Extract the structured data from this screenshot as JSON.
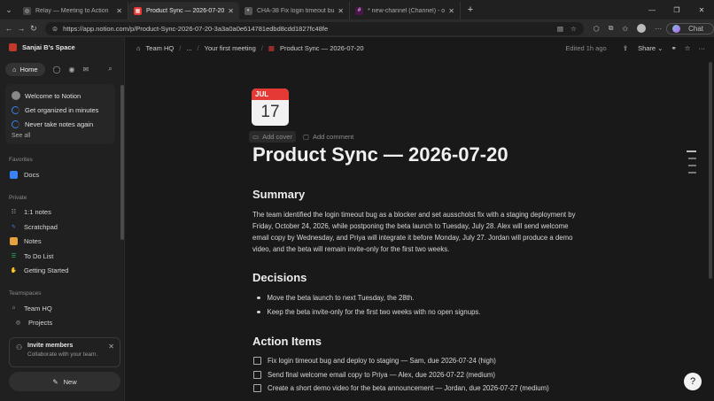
{
  "browser": {
    "tabs": [
      {
        "title": "Relay — Meeting to Action",
        "active": false
      },
      {
        "title": "Product Sync — 2026-07-20 | Notion",
        "active": true
      },
      {
        "title": "CHA-38 Fix login timeout bug and",
        "active": false
      },
      {
        "title": "* new-channel (Channel) - openai",
        "active": false
      }
    ],
    "url": "https://app.notion.com/p/Product-Sync-2026-07-20-3a3a0a0e614781edbd8cdd1827fc48fe",
    "chat_label": "Chat"
  },
  "sidebar": {
    "workspace": "Sanjai B's Space",
    "home_label": "Home",
    "onboarding": [
      {
        "label": "Welcome to Notion"
      },
      {
        "label": "Get organized in minutes"
      },
      {
        "label": "Never take notes again"
      }
    ],
    "see_all": "See all",
    "favorites_header": "Favorites",
    "favorites": [
      {
        "label": "Docs",
        "color": "#3b82f6"
      }
    ],
    "private_header": "Private",
    "private": [
      {
        "label": "1:1 notes",
        "color": "#888888"
      },
      {
        "label": "Scratchpad",
        "color": "#3b82f6"
      },
      {
        "label": "Notes",
        "color": "#e6a23c"
      },
      {
        "label": "To Do List",
        "color": "#22c55e"
      },
      {
        "label": "Getting Started",
        "color": "#f5c542"
      }
    ],
    "teamspaces_header": "Teamspaces",
    "teamspaces": [
      {
        "label": "Team HQ"
      },
      {
        "label": "Projects"
      }
    ],
    "invite_title": "Invite members",
    "invite_sub": "Collaborate with your team.",
    "new_label": "New"
  },
  "topbar": {
    "breadcrumb": [
      "Team HQ",
      "...",
      "Your first meeting",
      "Product Sync — 2026-07-20"
    ],
    "edited": "Edited 1h ago",
    "share": "Share"
  },
  "page": {
    "cal_month": "JUL",
    "cal_day": "17",
    "add_cover": "Add cover",
    "add_comment": "Add comment",
    "title": "Product Sync — 2026-07-20",
    "summary_heading": "Summary",
    "summary_text": "The team identified the login timeout bug as a blocker and set ausscholst fix with a staging deployment by Friday, October 24, 2026, while postponing the beta launch to Tuesday, July 28. Alex will send welcome email copy by Wednesday, and Priya will integrate it before Monday, July 27. Jordan will produce a demo video, and the beta will remain invite-only for the first two weeks.",
    "decisions_heading": "Decisions",
    "decisions": [
      "Move the beta launch to next Tuesday, the 28th.",
      "Keep the beta invite-only for the first two weeks with no open signups."
    ],
    "actions_heading": "Action Items",
    "actions": [
      "Fix login timeout bug and deploy to staging — Sam, due 2026-07-24 (high)",
      "Send final welcome email copy to Priya — Alex, due 2026-07-22 (medium)",
      "Create a short demo video for the beta announcement — Jordan, due 2026-07-27 (medium)"
    ]
  }
}
